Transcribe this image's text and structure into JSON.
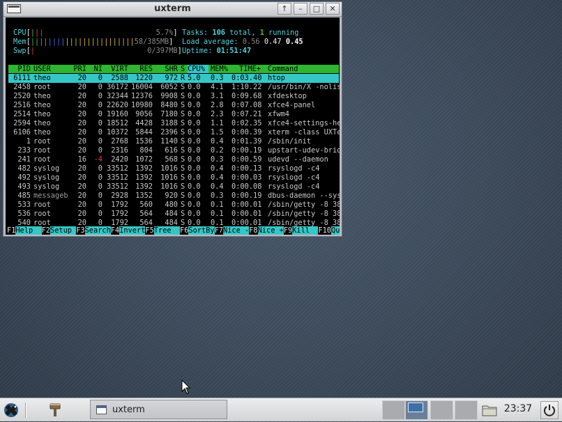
{
  "window": {
    "title": "uxterm",
    "buttons": {
      "up": "↑",
      "min": "–",
      "max": "□",
      "close": "✕"
    }
  },
  "meters": {
    "cpu_label": "CPU",
    "cpu_value": "5.7%",
    "mem_label": "Mem",
    "mem_value": "58/385MB",
    "swp_label": "Swp",
    "swp_value": "0/397MB"
  },
  "summary": {
    "tasks_label": "Tasks:",
    "tasks_total": "106",
    "tasks_total_label": "total,",
    "tasks_running": "1",
    "tasks_running_label": "running",
    "load_label": "Load average:",
    "load_1": "0.56",
    "load_5": "0.47",
    "load_15": "0.45",
    "uptime_label": "Uptime:",
    "uptime": "01:51:47"
  },
  "columns": [
    "PID",
    "USER",
    "PRI",
    "NI",
    "VIRT",
    "RES",
    "SHR",
    "S",
    "CPU%",
    "MEM%",
    "TIME+",
    "Command"
  ],
  "processes": [
    {
      "pid": "6111",
      "user": "theo",
      "pri": "20",
      "ni": "0",
      "virt": "2588",
      "res": "1220",
      "shr": "972",
      "s": "R",
      "cpu": "5.0",
      "mem": "0.3",
      "time": "0:03.40",
      "cmd": "htop"
    },
    {
      "pid": "2458",
      "user": "root",
      "pri": "20",
      "ni": "0",
      "virt": "36172",
      "res": "16004",
      "shr": "6052",
      "s": "S",
      "cpu": "0.0",
      "mem": "4.1",
      "time": "1:10.22",
      "cmd": "/usr/bin/X -nolist"
    },
    {
      "pid": "2520",
      "user": "theo",
      "pri": "20",
      "ni": "0",
      "virt": "32344",
      "res": "12376",
      "shr": "9908",
      "s": "S",
      "cpu": "0.0",
      "mem": "3.1",
      "time": "0:09.68",
      "cmd": "xfdesktop"
    },
    {
      "pid": "2516",
      "user": "theo",
      "pri": "20",
      "ni": "0",
      "virt": "22620",
      "res": "10980",
      "shr": "8480",
      "s": "S",
      "cpu": "0.0",
      "mem": "2.8",
      "time": "0:07.08",
      "cmd": "xfce4-panel"
    },
    {
      "pid": "2514",
      "user": "theo",
      "pri": "20",
      "ni": "0",
      "virt": "19160",
      "res": "9056",
      "shr": "7180",
      "s": "S",
      "cpu": "0.0",
      "mem": "2.3",
      "time": "0:07.21",
      "cmd": "xfwm4"
    },
    {
      "pid": "2594",
      "user": "theo",
      "pri": "20",
      "ni": "0",
      "virt": "18512",
      "res": "4428",
      "shr": "3188",
      "s": "S",
      "cpu": "0.0",
      "mem": "1.1",
      "time": "0:02.35",
      "cmd": "xfce4-settings-hel"
    },
    {
      "pid": "6106",
      "user": "theo",
      "pri": "20",
      "ni": "0",
      "virt": "10372",
      "res": "5844",
      "shr": "2396",
      "s": "S",
      "cpu": "0.0",
      "mem": "1.5",
      "time": "0:00.39",
      "cmd": "xterm -class UXTer"
    },
    {
      "pid": "1",
      "user": "root",
      "pri": "20",
      "ni": "0",
      "virt": "2768",
      "res": "1536",
      "shr": "1140",
      "s": "S",
      "cpu": "0.0",
      "mem": "0.4",
      "time": "0:01.39",
      "cmd": "/sbin/init"
    },
    {
      "pid": "233",
      "user": "root",
      "pri": "20",
      "ni": "0",
      "virt": "2316",
      "res": "804",
      "shr": "616",
      "s": "S",
      "cpu": "0.0",
      "mem": "0.2",
      "time": "0:00.19",
      "cmd": "upstart-udev-bridg"
    },
    {
      "pid": "241",
      "user": "root",
      "pri": "16",
      "ni": "-4",
      "virt": "2420",
      "res": "1072",
      "shr": "568",
      "s": "S",
      "cpu": "0.0",
      "mem": "0.3",
      "time": "0:00.59",
      "cmd": "udevd --daemon"
    },
    {
      "pid": "482",
      "user": "syslog",
      "pri": "20",
      "ni": "0",
      "virt": "33512",
      "res": "1392",
      "shr": "1016",
      "s": "S",
      "cpu": "0.0",
      "mem": "0.4",
      "time": "0:00.13",
      "cmd": "rsyslogd -c4"
    },
    {
      "pid": "492",
      "user": "syslog",
      "pri": "20",
      "ni": "0",
      "virt": "33512",
      "res": "1392",
      "shr": "1016",
      "s": "S",
      "cpu": "0.0",
      "mem": "0.4",
      "time": "0:00.03",
      "cmd": "rsyslogd -c4"
    },
    {
      "pid": "493",
      "user": "syslog",
      "pri": "20",
      "ni": "0",
      "virt": "33512",
      "res": "1392",
      "shr": "1016",
      "s": "S",
      "cpu": "0.0",
      "mem": "0.4",
      "time": "0:00.08",
      "cmd": "rsyslogd -c4"
    },
    {
      "pid": "485",
      "user": "messageb",
      "pri": "20",
      "ni": "0",
      "virt": "2928",
      "res": "1352",
      "shr": "920",
      "s": "S",
      "cpu": "0.0",
      "mem": "0.3",
      "time": "0:00.19",
      "cmd": "dbus-daemon --syst"
    },
    {
      "pid": "533",
      "user": "root",
      "pri": "20",
      "ni": "0",
      "virt": "1792",
      "res": "560",
      "shr": "480",
      "s": "S",
      "cpu": "0.0",
      "mem": "0.1",
      "time": "0:00.01",
      "cmd": "/sbin/getty -8 384"
    },
    {
      "pid": "536",
      "user": "root",
      "pri": "20",
      "ni": "0",
      "virt": "1792",
      "res": "564",
      "shr": "484",
      "s": "S",
      "cpu": "0.0",
      "mem": "0.1",
      "time": "0:00.01",
      "cmd": "/sbin/getty -8 384"
    },
    {
      "pid": "540",
      "user": "root",
      "pri": "20",
      "ni": "0",
      "virt": "1792",
      "res": "564",
      "shr": "484",
      "s": "S",
      "cpu": "0.0",
      "mem": "0.1",
      "time": "0:00.01",
      "cmd": "/sbin/getty -8 384"
    }
  ],
  "fkeys": [
    {
      "key": "F1",
      "label": "Help  "
    },
    {
      "key": "F2",
      "label": "Setup "
    },
    {
      "key": "F3",
      "label": "Search"
    },
    {
      "key": "F4",
      "label": "Invert"
    },
    {
      "key": "F5",
      "label": "Tree  "
    },
    {
      "key": "F6",
      "label": "SortBy"
    },
    {
      "key": "F7",
      "label": "Nice -"
    },
    {
      "key": "F8",
      "label": "Nice +"
    },
    {
      "key": "F9",
      "label": "Kill  "
    },
    {
      "key": "F10",
      "label": "Quit "
    }
  ],
  "taskbar": {
    "task_label": "uxterm",
    "clock": "23:37",
    "icons": [
      "xfce-mouse-icon",
      "paintbrush-icon",
      "terminal-window-icon",
      "folder-icon",
      "power-icon"
    ]
  },
  "colors": {
    "header_green": "#2fb52f",
    "selected_cyan": "#35c7c7",
    "meter_cyan": "#4fd2dc"
  }
}
